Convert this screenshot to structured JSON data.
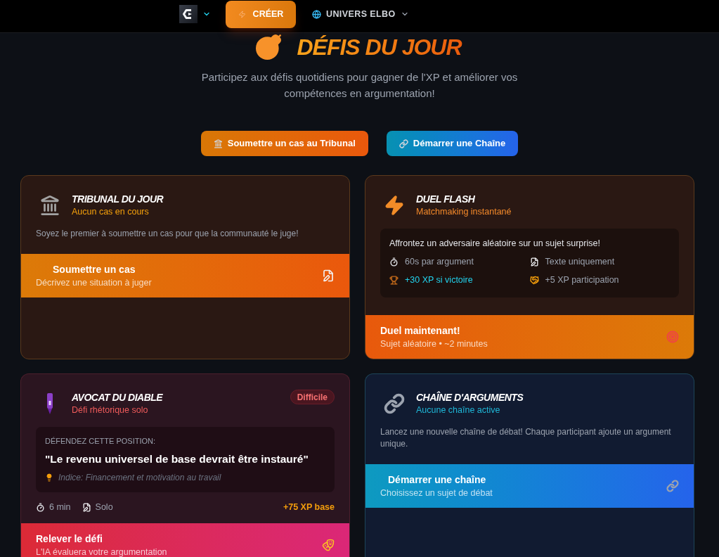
{
  "nav": {
    "create_button": "CRÉER",
    "universe_menu": "UNIVERS ELBO"
  },
  "header": {
    "title": "DÉFIS DU JOUR",
    "subtitle": "Participez aux défis quotidiens pour gagner de l'XP et améliorer vos compétences en argumentation!"
  },
  "quick_actions": [
    {
      "kind": "tribunal",
      "label": "Soumettre un cas au Tribunal"
    },
    {
      "kind": "chain",
      "label": "Démarrer une Chaîne"
    }
  ],
  "cards": [
    {
      "kind": "tribunal",
      "title": "TRIBUNAL DU JOUR",
      "subtitle": "Aucun cas en cours",
      "description": "Soyez le premier à soumettre un cas pour que la communauté le juge!",
      "action": {
        "title": "Soumettre un cas",
        "subtitle": "Décrivez une situation à juger"
      }
    },
    {
      "kind": "duel",
      "title": "DUEL FLASH",
      "subtitle": "Matchmaking instantané",
      "panel": {
        "text": "Affrontez un adversaire aléatoire sur un sujet surprise!",
        "features": [
          {
            "kind": "time",
            "text": "60s par argument"
          },
          {
            "kind": "format",
            "text": "Texte uniquement"
          },
          {
            "kind": "win",
            "text": "+30 XP si victoire"
          },
          {
            "kind": "participation",
            "text": "+5 XP participation"
          }
        ]
      },
      "action": {
        "title": "Duel maintenant!",
        "subtitle": "Sujet aléatoire • ~2 minutes"
      }
    },
    {
      "kind": "devil",
      "title": "AVOCAT DU DIABLE",
      "subtitle": "Défi rhétorique solo",
      "badge": "Difficile",
      "position": {
        "label": "DÉFENDEZ CETTE POSITION:",
        "quote": "\"Le revenu universel de base devrait être instauré\"",
        "hint": "Indice: Financement et motivation au travail"
      },
      "meta": [
        {
          "kind": "time",
          "text": "6 min"
        },
        {
          "kind": "format",
          "text": "Solo"
        }
      ],
      "reward": "+75 XP base",
      "action": {
        "title": "Relever le défi",
        "subtitle": "L'IA évaluera votre argumentation"
      }
    },
    {
      "kind": "chain",
      "title": "CHAÎNE D'ARGUMENTS",
      "subtitle": "Aucune chaîne active",
      "description": "Lancez une nouvelle chaîne de débat! Chaque participant ajoute un argument unique.",
      "action": {
        "title": "Démarrer une chaîne",
        "subtitle": "Choisissez un sujet de débat"
      }
    }
  ]
}
